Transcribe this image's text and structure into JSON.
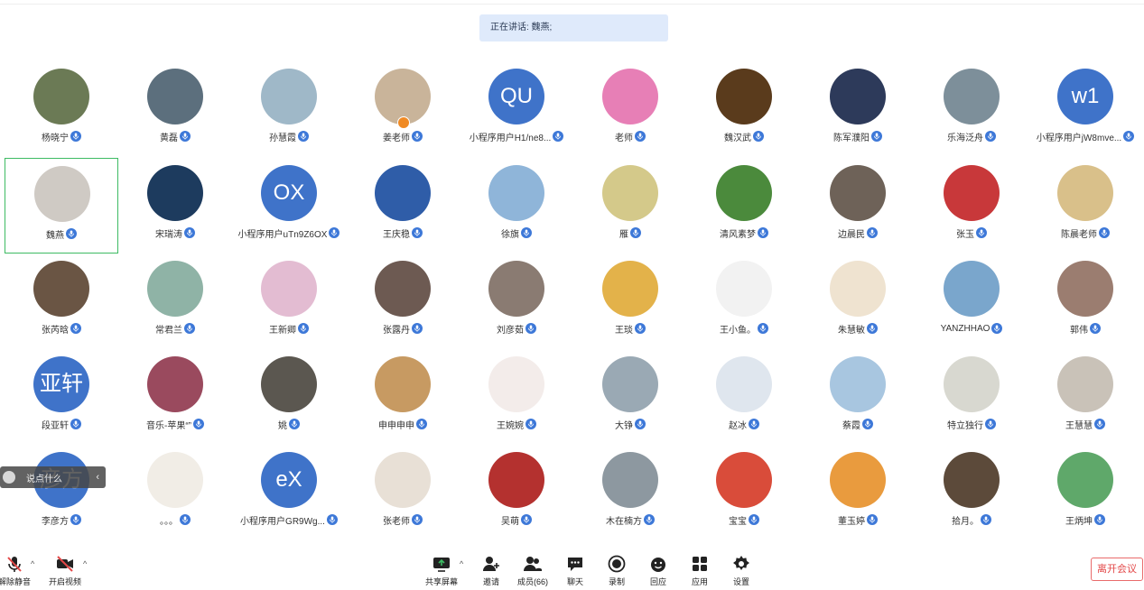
{
  "banner": {
    "text": "正在讲话: 魏燕;"
  },
  "participants": [
    {
      "name": "杨晓宁",
      "initials": "",
      "color": "#6b7a55",
      "host": false,
      "active": false
    },
    {
      "name": "黄磊",
      "initials": "",
      "color": "#5c6f7d",
      "host": false,
      "active": false
    },
    {
      "name": "孙慧霞",
      "initials": "",
      "color": "#9fb8c8",
      "host": false,
      "active": false
    },
    {
      "name": "姜老师",
      "initials": "",
      "color": "#c9b49a",
      "host": true,
      "active": false
    },
    {
      "name": "小程序用户H1/ne8...",
      "initials": "QU",
      "color": "#3f73c9",
      "host": false,
      "active": false
    },
    {
      "name": "老师",
      "initials": "",
      "color": "#e77fb6",
      "host": false,
      "active": false
    },
    {
      "name": "魏汉武",
      "initials": "",
      "color": "#5a3b1c",
      "host": false,
      "active": false
    },
    {
      "name": "陈军濮阳",
      "initials": "",
      "color": "#2d3a5a",
      "host": false,
      "active": false
    },
    {
      "name": "乐海泛舟",
      "initials": "",
      "color": "#7d8f9a",
      "host": false,
      "active": false
    },
    {
      "name": "小程序用户jW8mve...",
      "initials": "w1",
      "color": "#3f73c9",
      "host": false,
      "active": false
    },
    {
      "name": "魏燕",
      "initials": "",
      "color": "#cfcac4",
      "host": false,
      "active": true
    },
    {
      "name": "宋瑞涛",
      "initials": "",
      "color": "#1d3b5e",
      "host": false,
      "active": false
    },
    {
      "name": "小程序用户uTn9Z6OX",
      "initials": "OX",
      "color": "#3f73c9",
      "host": false,
      "active": false
    },
    {
      "name": "王庆稳",
      "initials": "",
      "color": "#2f5da8",
      "host": false,
      "active": false
    },
    {
      "name": "徐旗",
      "initials": "",
      "color": "#8fb5d9",
      "host": false,
      "active": false
    },
    {
      "name": "雁",
      "initials": "",
      "color": "#d4c98a",
      "host": false,
      "active": false
    },
    {
      "name": "清风素梦",
      "initials": "",
      "color": "#4b8a3c",
      "host": false,
      "active": false
    },
    {
      "name": "边晨民",
      "initials": "",
      "color": "#6e6258",
      "host": false,
      "active": false
    },
    {
      "name": "张玉",
      "initials": "",
      "color": "#c8383a",
      "host": false,
      "active": false
    },
    {
      "name": "陈晨老师",
      "initials": "",
      "color": "#d9c08a",
      "host": false,
      "active": false
    },
    {
      "name": "张芮晗",
      "initials": "",
      "color": "#6a5544",
      "host": false,
      "active": false
    },
    {
      "name": "常君兰",
      "initials": "",
      "color": "#8fb3a6",
      "host": false,
      "active": false
    },
    {
      "name": "王新卿",
      "initials": "",
      "color": "#e3bcd2",
      "host": false,
      "active": false
    },
    {
      "name": "张露丹",
      "initials": "",
      "color": "#6d5a52",
      "host": false,
      "active": false
    },
    {
      "name": "刘彦茹",
      "initials": "",
      "color": "#8a7b72",
      "host": false,
      "active": false
    },
    {
      "name": "王琰",
      "initials": "",
      "color": "#e3b24a",
      "host": false,
      "active": false
    },
    {
      "name": "王小鱼。",
      "initials": "",
      "color": "#f2f2f2",
      "host": false,
      "active": false
    },
    {
      "name": "朱慧敏",
      "initials": "",
      "color": "#efe3d0",
      "host": false,
      "active": false
    },
    {
      "name": "YANZHHAO",
      "initials": "",
      "color": "#7aa6cc",
      "host": false,
      "active": false
    },
    {
      "name": "郭伟",
      "initials": "",
      "color": "#9b7d70",
      "host": false,
      "active": false
    },
    {
      "name": "段亚轩",
      "initials": "亚轩",
      "color": "#3f73c9",
      "host": false,
      "active": false
    },
    {
      "name": "音乐-苹果“”",
      "initials": "",
      "color": "#9a4a5e",
      "host": false,
      "active": false
    },
    {
      "name": "姚",
      "initials": "",
      "color": "#5b5750",
      "host": false,
      "active": false
    },
    {
      "name": "申申申申",
      "initials": "",
      "color": "#c79a62",
      "host": false,
      "active": false
    },
    {
      "name": "王婉婉",
      "initials": "",
      "color": "#f3ecea",
      "host": false,
      "active": false
    },
    {
      "name": "大铮",
      "initials": "",
      "color": "#9aa9b4",
      "host": false,
      "active": false
    },
    {
      "name": "赵冰",
      "initials": "",
      "color": "#dfe6ee",
      "host": false,
      "active": false
    },
    {
      "name": "蔡霞",
      "initials": "",
      "color": "#a8c6e0",
      "host": false,
      "active": false
    },
    {
      "name": "特立独行",
      "initials": "",
      "color": "#d8d8d0",
      "host": false,
      "active": false
    },
    {
      "name": "王慧慧",
      "initials": "",
      "color": "#c9c2b8",
      "host": false,
      "active": false
    },
    {
      "name": "李彦方",
      "initials": "彦方",
      "color": "#3f73c9",
      "host": false,
      "active": false
    },
    {
      "name": "。。。",
      "initials": "",
      "color": "#f1ede6",
      "host": false,
      "active": false
    },
    {
      "name": "小程序用户GR9Wg...",
      "initials": "eX",
      "color": "#3f73c9",
      "host": false,
      "active": false
    },
    {
      "name": "张老师",
      "initials": "",
      "color": "#e8e0d6",
      "host": false,
      "active": false
    },
    {
      "name": "吴萌",
      "initials": "",
      "color": "#b4312f",
      "host": false,
      "active": false
    },
    {
      "name": "木在楠方",
      "initials": "",
      "color": "#8d98a0",
      "host": false,
      "active": false
    },
    {
      "name": "宝宝",
      "initials": "",
      "color": "#d94c3a",
      "host": false,
      "active": false
    },
    {
      "name": "董玉婷",
      "initials": "",
      "color": "#e99b3e",
      "host": false,
      "active": false
    },
    {
      "name": "拾月。",
      "initials": "",
      "color": "#5c4a3a",
      "host": false,
      "active": false
    },
    {
      "name": "王炳坤",
      "initials": "",
      "color": "#5fa86a",
      "host": false,
      "active": false
    }
  ],
  "comment_chip": {
    "placeholder": "说点什么"
  },
  "toolbar": {
    "unmute": "解除静音",
    "start_video": "开启视频",
    "share_screen": "共享屏幕",
    "invite": "邀请",
    "members": "成员(66)",
    "chat": "聊天",
    "record": "录制",
    "reaction": "回应",
    "apps": "应用",
    "settings": "设置",
    "leave": "离开会议"
  },
  "colors": {
    "accent": "#3d78d8",
    "active_border": "#3dbb63",
    "leave": "#e34848"
  }
}
